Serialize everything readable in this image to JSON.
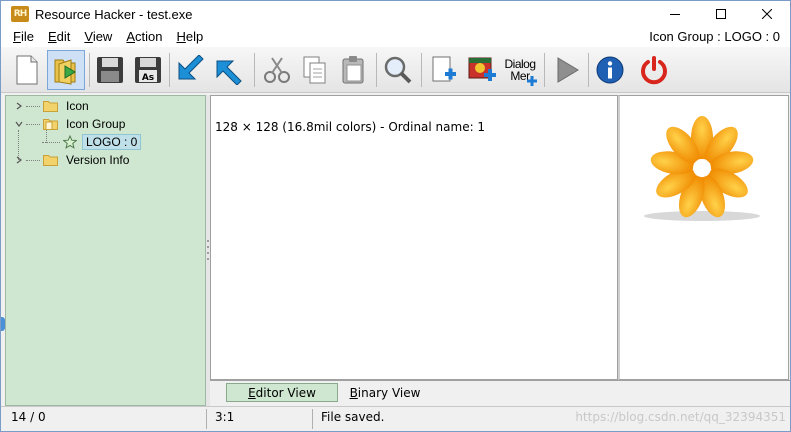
{
  "window": {
    "title": "Resource Hacker - test.exe",
    "app_logo": "RH"
  },
  "menu": {
    "items": [
      {
        "u": "F",
        "rest": "ile"
      },
      {
        "u": "E",
        "rest": "dit"
      },
      {
        "u": "V",
        "rest": "iew"
      },
      {
        "u": "A",
        "rest": "ction"
      },
      {
        "u": "H",
        "rest": "elp"
      }
    ],
    "status": "Icon Group : LOGO : 0"
  },
  "toolbar": {
    "dialog_menu_line1": "Dialog",
    "dialog_menu_line2": "Mer"
  },
  "tree": {
    "items": [
      {
        "label": "Icon",
        "expanded": false
      },
      {
        "label": "Icon Group",
        "expanded": true
      },
      {
        "label": "LOGO : 0",
        "selected": true
      },
      {
        "label": "Version Info",
        "expanded": false
      }
    ]
  },
  "editor": {
    "info": "128 × 128 (16.8mil colors) - Ordinal name: 1"
  },
  "tabs": [
    {
      "u": "E",
      "rest": "ditor View",
      "active": true
    },
    {
      "u": "B",
      "rest": "inary View",
      "active": false
    }
  ],
  "status": {
    "counts": "14 / 0",
    "position": "3:1",
    "message": "File saved.",
    "watermark": "https://blog.csdn.net/qq_32394351"
  },
  "colors": {
    "tree_bg": "#cfe7d1",
    "flower": "#f7a615",
    "power": "#d9261c",
    "info": "#1f5fb4"
  }
}
